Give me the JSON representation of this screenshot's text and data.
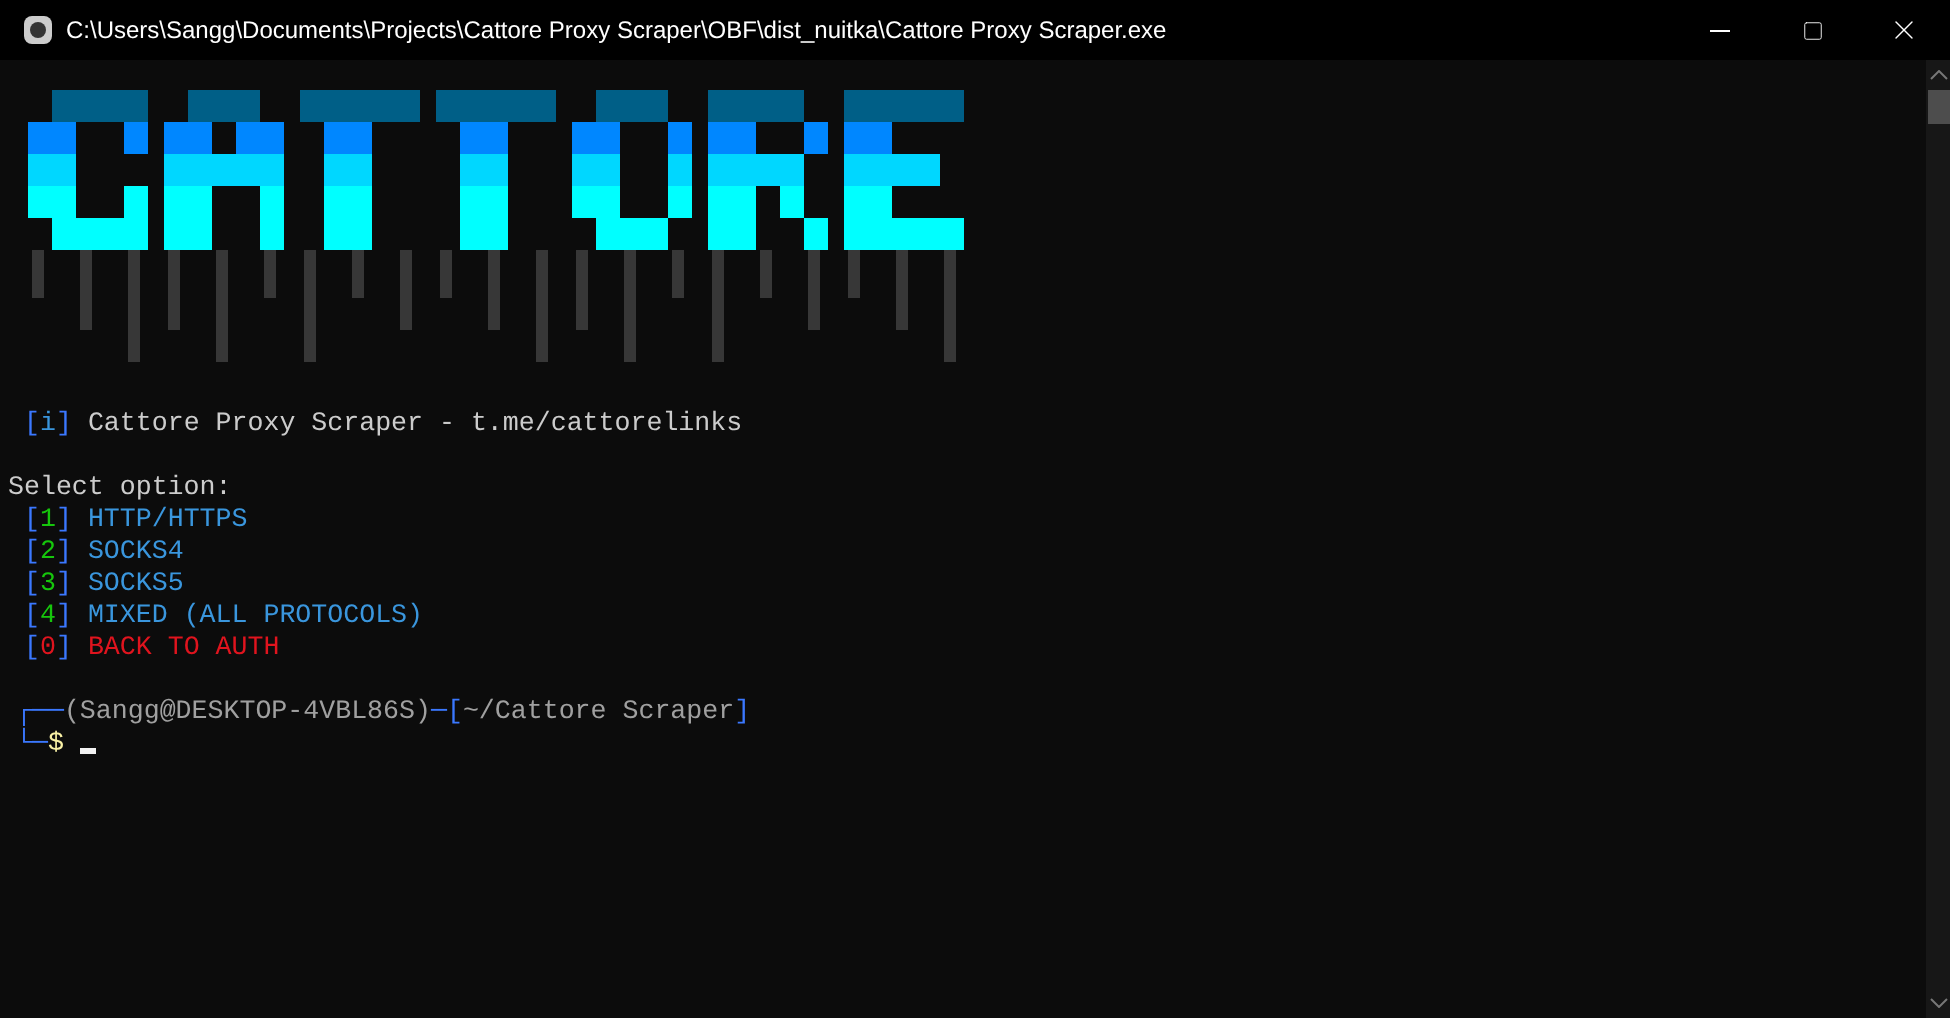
{
  "window": {
    "title": "C:\\Users\\Sangg\\Documents\\Projects\\Cattore Proxy Scraper\\OBF\\dist_nuitka\\Cattore Proxy Scraper.exe"
  },
  "terminal": {
    "info": {
      "open": "[",
      "key": "i",
      "close": "]",
      "text": "Cattore Proxy Scraper - t.me/cattorelinks"
    },
    "menu_title": "Select option:",
    "options": [
      {
        "open": "[",
        "key": "1",
        "close": "]",
        "label": "HTTP/HTTPS",
        "kind": "protocol"
      },
      {
        "open": "[",
        "key": "2",
        "close": "]",
        "label": "SOCKS4",
        "kind": "protocol"
      },
      {
        "open": "[",
        "key": "3",
        "close": "]",
        "label": "SOCKS5",
        "kind": "protocol"
      },
      {
        "open": "[",
        "key": "4",
        "close": "]",
        "label": "MIXED (ALL PROTOCOLS)",
        "kind": "protocol"
      },
      {
        "open": "[",
        "key": "0",
        "close": "]",
        "label": "BACK TO AUTH",
        "kind": "back"
      }
    ],
    "prompt": {
      "corner": "┌──",
      "host": "(Sangg@DESKTOP-4VBL86S)",
      "sep": "─[",
      "path": "~/Cattore Scraper",
      "end": "]",
      "corner2": "└─",
      "symbol": "$"
    }
  }
}
